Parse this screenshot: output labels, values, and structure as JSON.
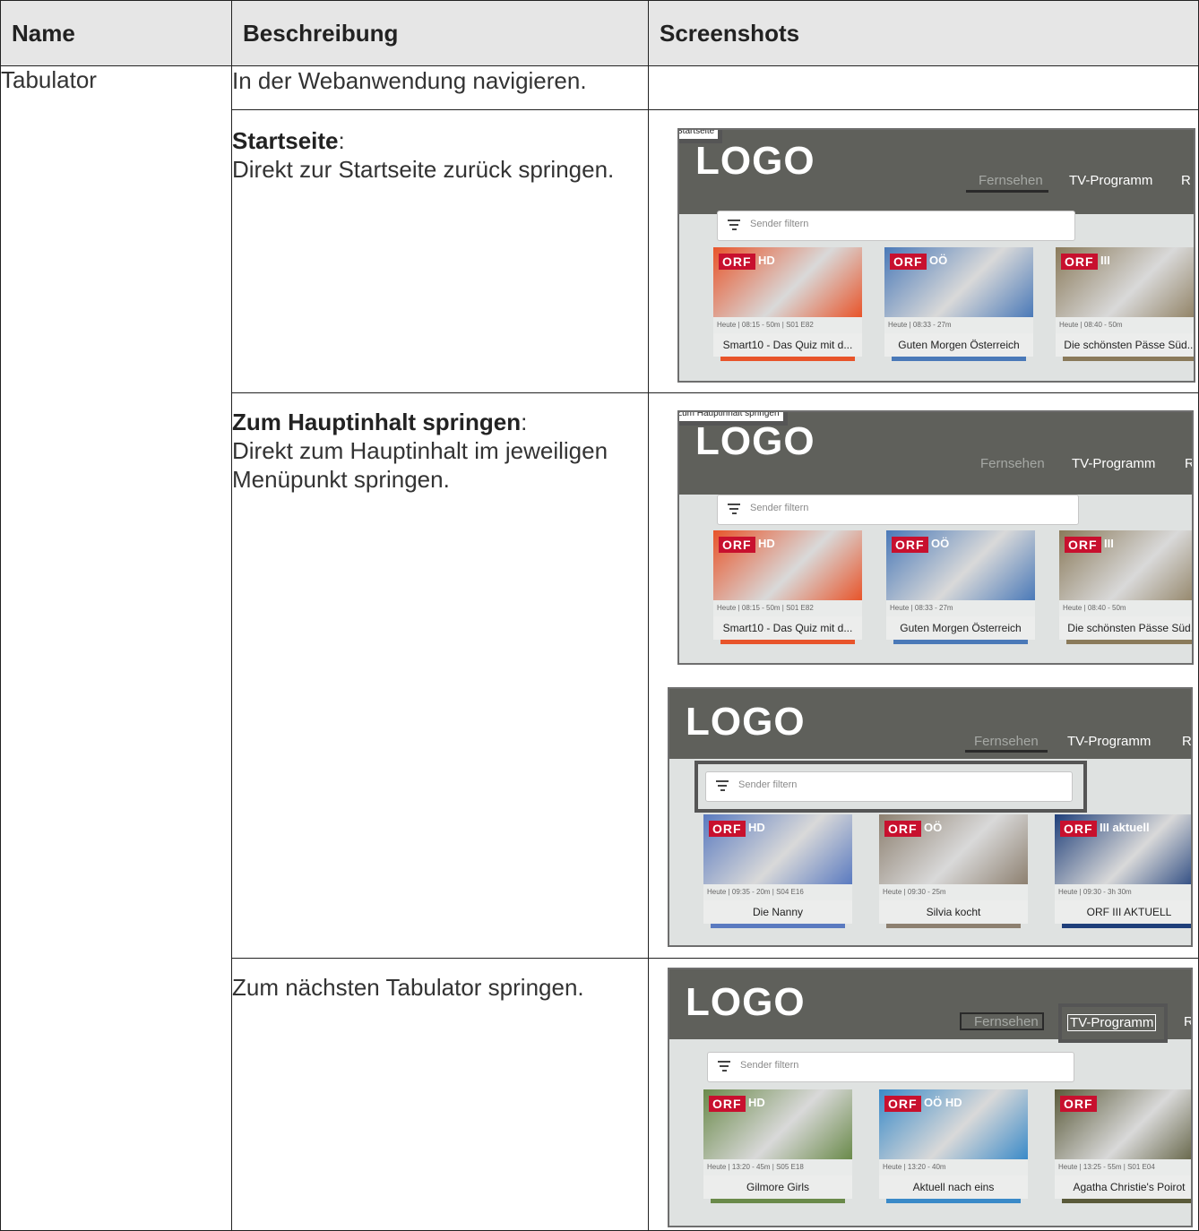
{
  "table": {
    "headers": [
      "Name",
      "Beschreibung",
      "Screenshots"
    ],
    "name": "Tabulator",
    "rows": [
      {
        "text": "In der Webanwendung navigieren."
      },
      {
        "bold": "Startseite",
        "suffix": ":",
        "text": "Direkt zur Startseite zurück springen."
      },
      {
        "bold": "Zum Hauptinhalt springen",
        "suffix": ":",
        "text": "Direkt zum Hauptinhalt im jeweiligen Menüpunkt springen."
      },
      {
        "text": "Zum nächsten Tabulator springen."
      }
    ]
  },
  "screenshots": {
    "logo": "LOGO",
    "nav_fernsehen": "Fernsehen",
    "nav_tv": "TV-Programm",
    "nav_r": "R",
    "search_placeholder": "Sender filtern",
    "skip_startseite": "Startseite",
    "skip_hauptinhalt": "Zum Hauptinhalt springen",
    "set_a": [
      {
        "orf": "ORF",
        "badge": "HD",
        "meta": "Heute | 08:15 - 50m | S01 E82",
        "title": "Smart10 - Das Quiz mit d...",
        "color": "#e8542a"
      },
      {
        "orf": "ORF",
        "badge": "OÖ",
        "meta": "Heute | 08:33 - 27m",
        "title": "Guten Morgen Österreich",
        "color": "#4a79b8"
      },
      {
        "orf": "ORF",
        "badge": "III",
        "meta": "Heute | 08:40 - 50m",
        "title": "Die schönsten Pässe Süd...",
        "color": "#8a7a5a"
      }
    ],
    "set_b": [
      {
        "orf": "ORF",
        "badge": "HD",
        "meta": "Heute | 09:35 - 20m | S04 E16",
        "title": "Die Nanny",
        "color": "#5a7ac0"
      },
      {
        "orf": "ORF",
        "badge": "OÖ",
        "meta": "Heute | 09:30 - 25m",
        "title": "Silvia kocht",
        "color": "#8d8070"
      },
      {
        "orf": "ORF",
        "badge": "III aktuell",
        "meta": "Heute | 09:30 - 3h 30m",
        "title": "ORF III AKTUELL",
        "color": "#1f3f7a"
      }
    ],
    "set_c": [
      {
        "orf": "ORF",
        "badge": "HD",
        "meta": "Heute | 13:20 - 45m | S05 E18",
        "title": "Gilmore Girls",
        "color": "#6a8a4a"
      },
      {
        "orf": "ORF",
        "badge": "OÖ HD",
        "meta": "Heute | 13:20 - 40m",
        "title": "Aktuell nach eins",
        "color": "#3a8ac8"
      },
      {
        "orf": "ORF",
        "badge": "",
        "meta": "Heute | 13:25 - 55m | S01 E04",
        "title": "Agatha Christie's Poirot",
        "color": "#5a5a3a"
      }
    ]
  }
}
